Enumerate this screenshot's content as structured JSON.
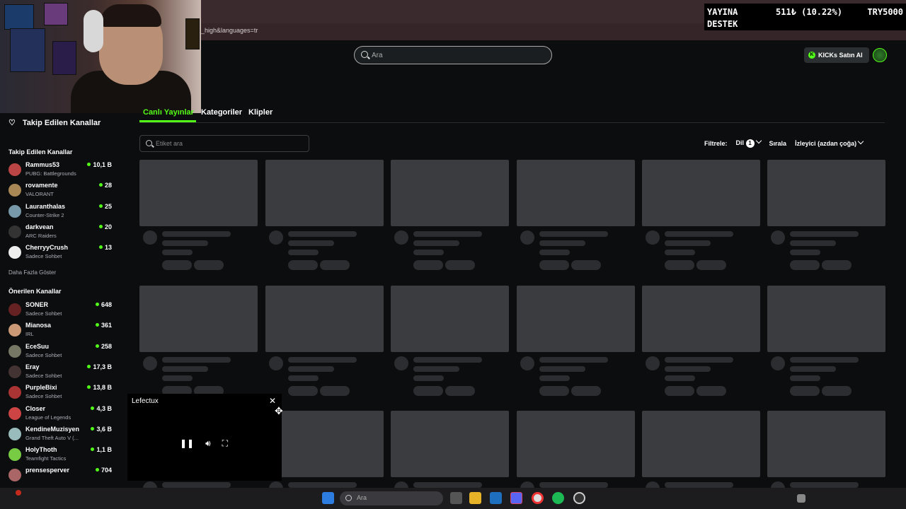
{
  "browser": {
    "url_fragment": "_high&languages=tr"
  },
  "overlay": {
    "line1": "YAYINA",
    "line2": "DESTEK",
    "amount": "511₺ (10.22%)",
    "goal": "TRY5000"
  },
  "header": {
    "search_placeholder": "Ara",
    "kicks_button": "KICKs Satın Al"
  },
  "sidebar": {
    "followed_title": "Takip Edilen Kanallar",
    "followed_section": "Takip Edilen Kanallar",
    "followed": [
      {
        "name": "Rammus53",
        "game": "PUBG: Battlegrounds",
        "viewers": "10,1 B",
        "color": "#b44"
      },
      {
        "name": "rovamente",
        "game": "VALORANT",
        "viewers": "28",
        "color": "#a85"
      },
      {
        "name": "Lauranthalas",
        "game": "Counter-Strike 2",
        "viewers": "25",
        "color": "#79a"
      },
      {
        "name": "darkvean",
        "game": "ARC Raiders",
        "viewers": "20",
        "color": "#333"
      },
      {
        "name": "CherryyCrush",
        "game": "Sadece Sohbet",
        "viewers": "13",
        "color": "#eee"
      }
    ],
    "show_more": "Daha Fazla Göster",
    "recommended_section": "Önerilen Kanallar",
    "recommended": [
      {
        "name": "SONER",
        "game": "Sadece Sohbet",
        "viewers": "648",
        "color": "#622"
      },
      {
        "name": "Mianosa",
        "game": "IRL",
        "viewers": "361",
        "color": "#c97"
      },
      {
        "name": "EceSuu",
        "game": "Sadece Sohbet",
        "viewers": "258",
        "color": "#776"
      },
      {
        "name": "Eray",
        "game": "Sadece Sohbet",
        "viewers": "17,3 B",
        "color": "#433"
      },
      {
        "name": "PurpleBixi",
        "game": "Sadece Sohbet",
        "viewers": "13,8 B",
        "color": "#a33"
      },
      {
        "name": "Closer",
        "game": "League of Legends",
        "viewers": "4,3 B",
        "color": "#c44"
      },
      {
        "name": "KendineMuzisyen",
        "game": "Grand Theft Auto V (...",
        "viewers": "3,6 B",
        "color": "#9bb"
      },
      {
        "name": "HolyThoth",
        "game": "Teamfight Tactics",
        "viewers": "1,1 B",
        "color": "#7c4"
      },
      {
        "name": "prensesperver",
        "game": "",
        "viewers": "704",
        "color": "#a66"
      }
    ]
  },
  "tabs": {
    "live": "Canlı Yayınlar",
    "categories": "Kategoriler",
    "clips": "Klipler"
  },
  "toolbar": {
    "tag_placeholder": "Etiket ara",
    "filter_label": "Filtrele:",
    "language_label": "Dil",
    "language_count": "1",
    "sort_label": "Sırala",
    "sort_value": "İzleyici (azdan çoğa)"
  },
  "miniplayer": {
    "title": "Lefectux"
  },
  "taskbar": {
    "search_placeholder": "Ara"
  },
  "colors": {
    "accent": "#53fc18",
    "background": "#0b0d0e"
  }
}
